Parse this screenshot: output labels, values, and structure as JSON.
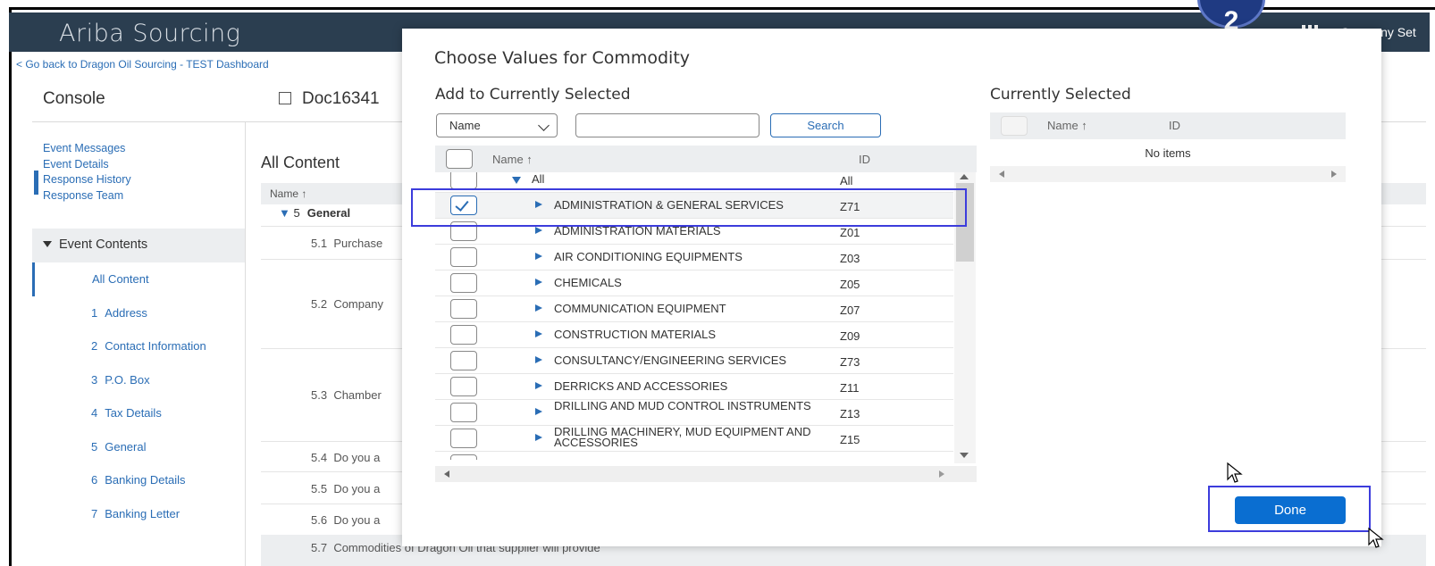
{
  "header": {
    "brand": "Ariba Sourcing",
    "company_label": "Company Set",
    "step_badge": "2"
  },
  "back_link": "< Go back to Dragon Oil Sourcing - TEST Dashboard",
  "console": {
    "title": "Console",
    "doc_title": "Doc16341",
    "event_links": [
      "Event Messages",
      "Event Details",
      "Response History",
      "Response Team"
    ],
    "event_contents_label": "Event Contents",
    "all_content_label": "All Content",
    "nav": [
      {
        "num": "1",
        "label": "Address"
      },
      {
        "num": "2",
        "label": "Contact Information"
      },
      {
        "num": "3",
        "label": "P.O. Box"
      },
      {
        "num": "4",
        "label": "Tax Details"
      },
      {
        "num": "5",
        "label": "General"
      },
      {
        "num": "6",
        "label": "Banking Details"
      },
      {
        "num": "7",
        "label": "Banking Letter"
      }
    ]
  },
  "main": {
    "section_title": "All Content",
    "name_header": "Name ↑",
    "general_num": "5",
    "general_label": "General",
    "items": [
      {
        "num": "5.1",
        "label": "Purchase"
      },
      {
        "num": "5.2",
        "label": "Company"
      },
      {
        "num": "5.3",
        "label": "Chamber"
      },
      {
        "num": "5.4",
        "label": "Do you a"
      },
      {
        "num": "5.5",
        "label": "Do you a"
      },
      {
        "num": "5.6",
        "label": "Do you a"
      },
      {
        "num": "5.7",
        "label": "Commodities of Dragon Oil that supplier will provide"
      }
    ]
  },
  "dialog": {
    "title": "Choose Values for Commodity",
    "add_title": "Add to Currently Selected",
    "current_title": "Currently Selected",
    "search_field_select": "Name",
    "search_button": "Search",
    "col_name": "Name ↑",
    "col_id": "ID",
    "rows": [
      {
        "name": "All",
        "id": "All"
      },
      {
        "name": "ADMINISTRATION & GENERAL SERVICES",
        "id": "Z71",
        "checked": true
      },
      {
        "name": "ADMINISTRATION MATERIALS",
        "id": "Z01"
      },
      {
        "name": "AIR CONDITIONING EQUIPMENTS",
        "id": "Z03"
      },
      {
        "name": "CHEMICALS",
        "id": "Z05"
      },
      {
        "name": "COMMUNICATION EQUIPMENT",
        "id": "Z07"
      },
      {
        "name": "CONSTRUCTION MATERIALS",
        "id": "Z09"
      },
      {
        "name": "CONSULTANCY/ENGINEERING SERVICES",
        "id": "Z73"
      },
      {
        "name": "DERRICKS AND ACCESSORIES",
        "id": "Z11"
      },
      {
        "name": "DRILLING AND MUD CONTROL INSTRUMENTS",
        "id": "Z13"
      },
      {
        "name": "DRILLING MACHINERY, MUD EQUIPMENT AND ACCESSORIES",
        "id": "Z15"
      }
    ],
    "current_col_name": "Name ↑",
    "current_col_id": "ID",
    "no_items": "No items",
    "done_button": "Done"
  }
}
